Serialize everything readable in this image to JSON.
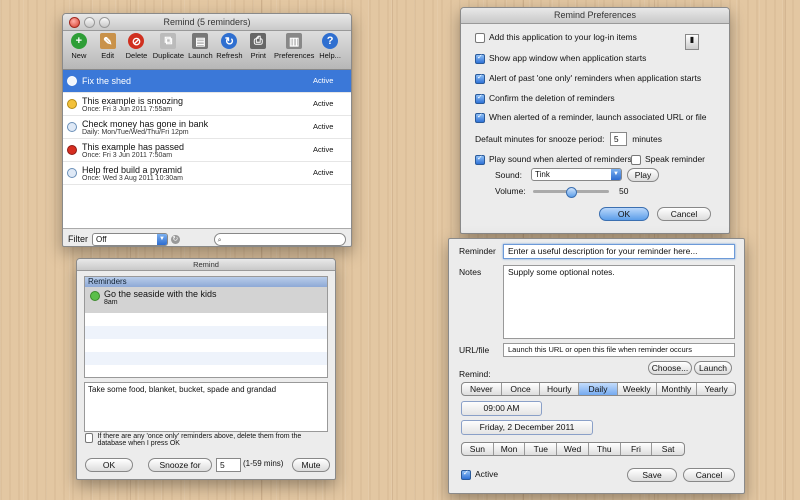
{
  "main_window": {
    "title": "Remind (5 reminders)",
    "toolbar": [
      {
        "label": "New",
        "icon": "plus-icon",
        "color": "#2f9e37"
      },
      {
        "label": "Edit",
        "icon": "pencil-icon",
        "color": "#b07a3a"
      },
      {
        "label": "Delete",
        "icon": "delete-icon",
        "color": "#d0301f"
      },
      {
        "label": "Duplicate",
        "icon": "duplicate-icon",
        "color": "#7a7a7a"
      },
      {
        "label": "Launch",
        "icon": "launch-icon",
        "color": "#555555"
      },
      {
        "label": "Refresh",
        "icon": "refresh-icon",
        "color": "#2f6fd0"
      },
      {
        "label": "Print",
        "icon": "printer-icon",
        "color": "#666666"
      },
      {
        "label": "Preferences",
        "icon": "preferences-icon",
        "color": "#777777"
      },
      {
        "label": "Help...",
        "icon": "help-icon",
        "color": "#2f6fd0"
      }
    ],
    "reminders": [
      {
        "title": "Fix the shed",
        "subtitle": "",
        "status": "Active"
      },
      {
        "title": "This example is snoozing",
        "subtitle": "Once: Fri 3 Jun 2011  7:55am",
        "status": "Active"
      },
      {
        "title": "Check money has gone in bank",
        "subtitle": "Daily: Mon/Tue/Wed/Thu/Fri 12pm",
        "status": "Active"
      },
      {
        "title": "This example has passed",
        "subtitle": "Once: Fri 3 Jun 2011  7:50am",
        "status": "Active"
      },
      {
        "title": "Help fred build a pyramid",
        "subtitle": "Once: Wed 3 Aug 2011  10:30am",
        "status": "Active"
      }
    ],
    "filter_label": "Filter",
    "filter_value": "Off"
  },
  "alert_window": {
    "title": "Remind",
    "list_header": "Reminders",
    "item_title": "Go the seaside with the kids",
    "item_time": "8am",
    "notes": "Take some food, blanket, bucket, spade and grandad",
    "delete_option": "If there are any 'once only' reminders above, delete them from the database when I press OK",
    "ok": "OK",
    "snooze_for": "Snooze for",
    "snooze_value": "5",
    "snooze_range": "(1-59 mins)",
    "mute": "Mute"
  },
  "prefs": {
    "title": "Remind Preferences",
    "options": [
      {
        "label": "Add this application to your log-in items",
        "checked": false
      },
      {
        "label": "Show app window when application starts",
        "checked": true
      },
      {
        "label": "Alert of past 'one only' reminders when application starts",
        "checked": true
      },
      {
        "label": "Confirm the deletion of reminders",
        "checked": true
      },
      {
        "label": "When alerted of a reminder, launch associated URL or file",
        "checked": true
      }
    ],
    "snooze_label": "Default minutes for snooze period:",
    "snooze_value": "5",
    "snooze_unit": "minutes",
    "play_sound": "Play sound when alerted of reminders",
    "speak": "Speak reminder",
    "sound_label": "Sound:",
    "sound_value": "Tink",
    "play": "Play",
    "volume_label": "Volume:",
    "volume_value": "50",
    "volume_level": 0.5,
    "ok": "OK",
    "cancel": "Cancel"
  },
  "editor": {
    "reminder_label": "Reminder",
    "reminder_value": "Enter a useful description for your reminder here...",
    "notes_label": "Notes",
    "notes_value": "Supply some optional notes.",
    "url_label": "URL/file",
    "url_value": "Launch this URL or open this file when reminder occurs",
    "choose": "Choose...",
    "launch": "Launch",
    "remind_label": "Remind:",
    "frequencies": [
      "Never",
      "Once",
      "Hourly",
      "Daily",
      "Weekly",
      "Monthly",
      "Yearly"
    ],
    "selected_frequency": "Daily",
    "time": "09:00 AM",
    "date": "Friday, 2 December 2011",
    "days": [
      "Sun",
      "Mon",
      "Tue",
      "Wed",
      "Thu",
      "Fri",
      "Sat"
    ],
    "active": "Active",
    "save": "Save",
    "cancel": "Cancel"
  }
}
